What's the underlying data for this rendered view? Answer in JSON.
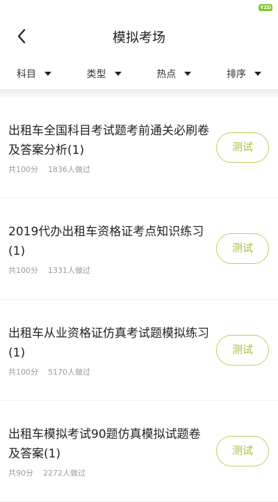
{
  "status": {
    "logo": "YZD"
  },
  "header": {
    "title": "模拟考场",
    "back_icon": "chevron-left-icon"
  },
  "filters": [
    {
      "label": "科目",
      "icon": "caret-down-icon"
    },
    {
      "label": "类型",
      "icon": "caret-down-icon"
    },
    {
      "label": "热点",
      "icon": "caret-down-icon"
    },
    {
      "label": "排序",
      "icon": "caret-down-icon"
    }
  ],
  "colors": {
    "accent": "#a0c03c",
    "accent_border": "#b7d15a",
    "logo": "#7ec82a"
  },
  "exams": [
    {
      "title": "出租车全国科目考试题考前通关必刷卷及答案分析(1)",
      "score": "共100分",
      "count": "1836人做过",
      "button": "测试"
    },
    {
      "title": "2019代办出租车资格证考点知识练习(1)",
      "score": "共100分",
      "count": "1331人做过",
      "button": "测试"
    },
    {
      "title": "出租车从业资格证仿真考试题模拟练习(1)",
      "score": "共100分",
      "count": "5170人做过",
      "button": "测试"
    },
    {
      "title": "出租车模拟考试90题仿真模拟试题卷及答案(1)",
      "score": "共90分",
      "count": "2272人做过",
      "button": "测试"
    }
  ]
}
